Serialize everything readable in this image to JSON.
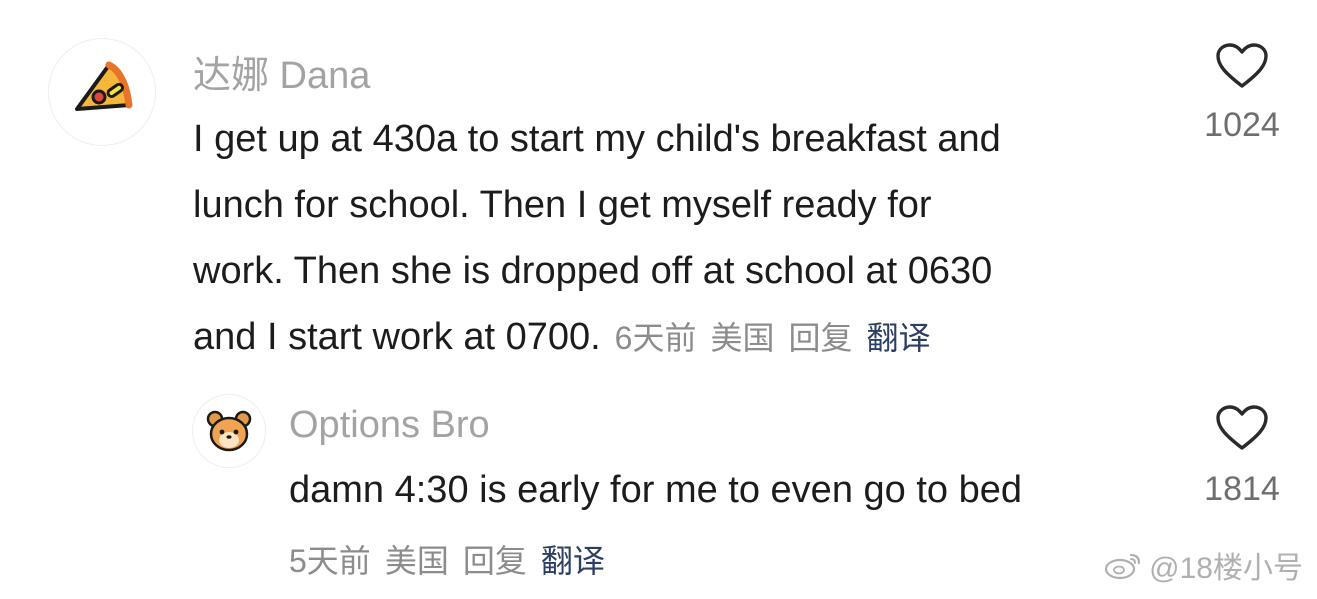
{
  "comments": [
    {
      "username": "达娜 Dana",
      "avatar_icon": "pizza-slice-icon",
      "text": "I get up at 430a to start my child's breakfast and\nlunch for school. Then I get myself ready for\nwork. Then she is dropped off at school at 0630\nand I start work at 0700.",
      "time": "6天前",
      "location": "美国",
      "reply": "回复",
      "translate": "翻译",
      "likes": "1024"
    },
    {
      "username": "Options Bro",
      "avatar_icon": "hamster-icon",
      "text": "damn 4:30 is early for me to even go to bed",
      "time": "5天前",
      "location": "美国",
      "reply": "回复",
      "translate": "翻译",
      "likes": "1814"
    }
  ],
  "watermark": {
    "icon": "weibo-icon",
    "text": "@18楼小号"
  },
  "colors": {
    "username": "#a3a3a3",
    "body": "#1c1c1c",
    "meta": "#8c8c8c",
    "translate_link": "#2c3e63"
  }
}
